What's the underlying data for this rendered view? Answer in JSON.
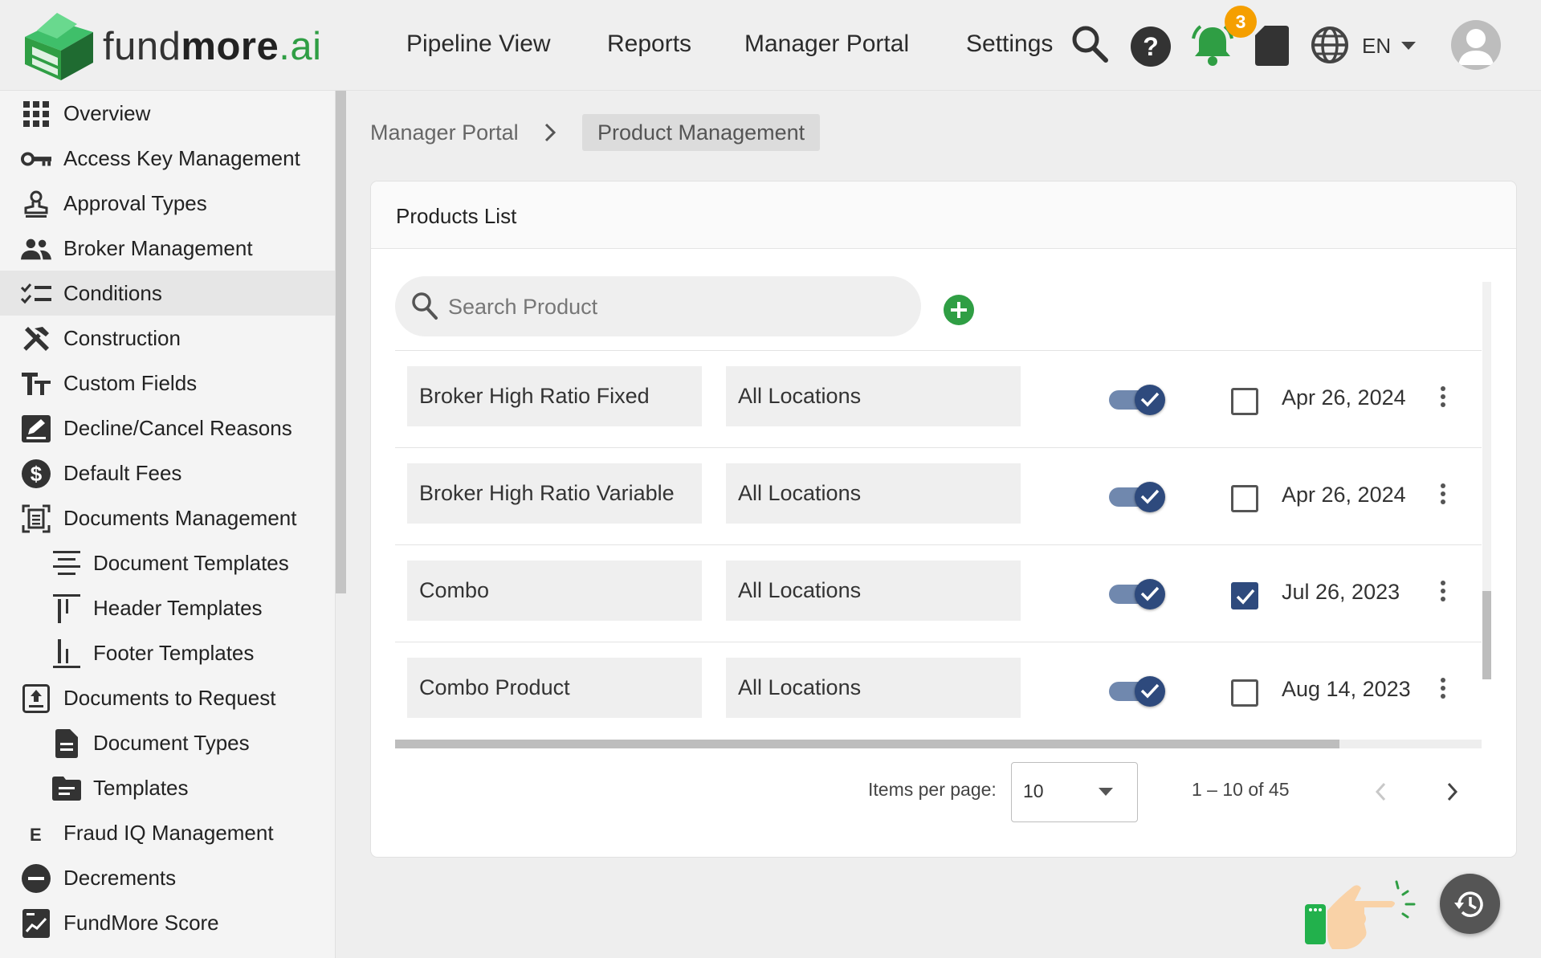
{
  "brand": {
    "logo_text_light": "fund",
    "logo_text_bold": "more",
    "logo_text_ai": ".ai",
    "accent_green": "#2f9e44",
    "accent_navy": "#2e4a7d"
  },
  "header": {
    "nav": [
      "Pipeline View",
      "Reports",
      "Manager Portal",
      "Settings"
    ],
    "notification_count": "3",
    "language": "EN",
    "icons": [
      "search-icon",
      "help-icon",
      "bell-icon",
      "document-icon",
      "globe-icon",
      "chevron-down-icon",
      "avatar-icon"
    ]
  },
  "sidebar": {
    "active_item": "Conditions",
    "items": [
      {
        "label": "Overview",
        "icon": "grid-icon"
      },
      {
        "label": "Access Key Management",
        "icon": "key-icon"
      },
      {
        "label": "Approval Types",
        "icon": "stamp-icon"
      },
      {
        "label": "Broker Management",
        "icon": "people-icon"
      },
      {
        "label": "Conditions",
        "icon": "checklist-icon"
      },
      {
        "label": "Construction",
        "icon": "tools-icon"
      },
      {
        "label": "Custom Fields",
        "icon": "text-fields-icon"
      },
      {
        "label": "Decline/Cancel Reasons",
        "icon": "edit-box-icon"
      },
      {
        "label": "Default Fees",
        "icon": "dollar-icon"
      },
      {
        "label": "Documents Management",
        "icon": "document-scan-icon"
      },
      {
        "label": "Document Templates",
        "icon": "align-center-icon"
      },
      {
        "label": "Header Templates",
        "icon": "header-icon"
      },
      {
        "label": "Footer Templates",
        "icon": "footer-icon"
      },
      {
        "label": "Documents to Request",
        "icon": "upload-box-icon"
      },
      {
        "label": "Document Types",
        "icon": "file-text-icon"
      },
      {
        "label": "Templates",
        "icon": "folder-icon"
      },
      {
        "label": "Fraud IQ Management",
        "icon": "letter-e-icon"
      },
      {
        "label": "Decrements",
        "icon": "minus-circle-icon"
      },
      {
        "label": "FundMore Score",
        "icon": "score-icon"
      }
    ]
  },
  "breadcrumb": {
    "parent": "Manager Portal",
    "current": "Product Management"
  },
  "products": {
    "title": "Products List",
    "search_placeholder": "Search Product",
    "rows": [
      {
        "name": "Broker High Ratio Fixed",
        "location": "All Locations",
        "enabled": true,
        "checked": false,
        "date": "Apr 26, 2024"
      },
      {
        "name": "Broker High Ratio Variable",
        "location": "All Locations",
        "enabled": true,
        "checked": false,
        "date": "Apr 26, 2024"
      },
      {
        "name": "Combo",
        "location": "All Locations",
        "enabled": true,
        "checked": true,
        "date": "Jul 26, 2023"
      },
      {
        "name": "Combo Product",
        "location": "All Locations",
        "enabled": true,
        "checked": false,
        "date": "Aug 14, 2023"
      }
    ],
    "pagination": {
      "items_per_page_label": "Items per page:",
      "items_per_page": "10",
      "range": "1 – 10 of 45"
    }
  }
}
